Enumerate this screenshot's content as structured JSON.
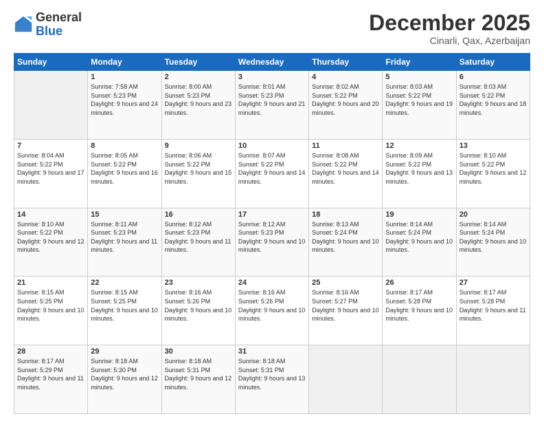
{
  "logo": {
    "line1": "General",
    "line2": "Blue"
  },
  "title": "December 2025",
  "location": "Cinarli, Qax, Azerbaijan",
  "days_header": [
    "Sunday",
    "Monday",
    "Tuesday",
    "Wednesday",
    "Thursday",
    "Friday",
    "Saturday"
  ],
  "weeks": [
    [
      {
        "num": "",
        "empty": true
      },
      {
        "num": "1",
        "sunrise": "7:58 AM",
        "sunset": "5:23 PM",
        "daylight": "9 hours and 24 minutes."
      },
      {
        "num": "2",
        "sunrise": "8:00 AM",
        "sunset": "5:23 PM",
        "daylight": "9 hours and 23 minutes."
      },
      {
        "num": "3",
        "sunrise": "8:01 AM",
        "sunset": "5:23 PM",
        "daylight": "9 hours and 21 minutes."
      },
      {
        "num": "4",
        "sunrise": "8:02 AM",
        "sunset": "5:22 PM",
        "daylight": "9 hours and 20 minutes."
      },
      {
        "num": "5",
        "sunrise": "8:03 AM",
        "sunset": "5:22 PM",
        "daylight": "9 hours and 19 minutes."
      },
      {
        "num": "6",
        "sunrise": "8:03 AM",
        "sunset": "5:22 PM",
        "daylight": "9 hours and 18 minutes."
      }
    ],
    [
      {
        "num": "7",
        "sunrise": "8:04 AM",
        "sunset": "5:22 PM",
        "daylight": "9 hours and 17 minutes."
      },
      {
        "num": "8",
        "sunrise": "8:05 AM",
        "sunset": "5:22 PM",
        "daylight": "9 hours and 16 minutes."
      },
      {
        "num": "9",
        "sunrise": "8:06 AM",
        "sunset": "5:22 PM",
        "daylight": "9 hours and 15 minutes."
      },
      {
        "num": "10",
        "sunrise": "8:07 AM",
        "sunset": "5:22 PM",
        "daylight": "9 hours and 14 minutes."
      },
      {
        "num": "11",
        "sunrise": "8:08 AM",
        "sunset": "5:22 PM",
        "daylight": "9 hours and 14 minutes."
      },
      {
        "num": "12",
        "sunrise": "8:09 AM",
        "sunset": "5:22 PM",
        "daylight": "9 hours and 13 minutes."
      },
      {
        "num": "13",
        "sunrise": "8:10 AM",
        "sunset": "5:22 PM",
        "daylight": "9 hours and 12 minutes."
      }
    ],
    [
      {
        "num": "14",
        "sunrise": "8:10 AM",
        "sunset": "5:22 PM",
        "daylight": "9 hours and 12 minutes."
      },
      {
        "num": "15",
        "sunrise": "8:11 AM",
        "sunset": "5:23 PM",
        "daylight": "9 hours and 11 minutes."
      },
      {
        "num": "16",
        "sunrise": "8:12 AM",
        "sunset": "5:23 PM",
        "daylight": "9 hours and 11 minutes."
      },
      {
        "num": "17",
        "sunrise": "8:12 AM",
        "sunset": "5:23 PM",
        "daylight": "9 hours and 10 minutes."
      },
      {
        "num": "18",
        "sunrise": "8:13 AM",
        "sunset": "5:24 PM",
        "daylight": "9 hours and 10 minutes."
      },
      {
        "num": "19",
        "sunrise": "8:14 AM",
        "sunset": "5:24 PM",
        "daylight": "9 hours and 10 minutes."
      },
      {
        "num": "20",
        "sunrise": "8:14 AM",
        "sunset": "5:24 PM",
        "daylight": "9 hours and 10 minutes."
      }
    ],
    [
      {
        "num": "21",
        "sunrise": "8:15 AM",
        "sunset": "5:25 PM",
        "daylight": "9 hours and 10 minutes."
      },
      {
        "num": "22",
        "sunrise": "8:15 AM",
        "sunset": "5:25 PM",
        "daylight": "9 hours and 10 minutes."
      },
      {
        "num": "23",
        "sunrise": "8:16 AM",
        "sunset": "5:26 PM",
        "daylight": "9 hours and 10 minutes."
      },
      {
        "num": "24",
        "sunrise": "8:16 AM",
        "sunset": "5:26 PM",
        "daylight": "9 hours and 10 minutes."
      },
      {
        "num": "25",
        "sunrise": "8:16 AM",
        "sunset": "5:27 PM",
        "daylight": "9 hours and 10 minutes."
      },
      {
        "num": "26",
        "sunrise": "8:17 AM",
        "sunset": "5:28 PM",
        "daylight": "9 hours and 10 minutes."
      },
      {
        "num": "27",
        "sunrise": "8:17 AM",
        "sunset": "5:28 PM",
        "daylight": "9 hours and 11 minutes."
      }
    ],
    [
      {
        "num": "28",
        "sunrise": "8:17 AM",
        "sunset": "5:29 PM",
        "daylight": "9 hours and 11 minutes."
      },
      {
        "num": "29",
        "sunrise": "8:18 AM",
        "sunset": "5:30 PM",
        "daylight": "9 hours and 12 minutes."
      },
      {
        "num": "30",
        "sunrise": "8:18 AM",
        "sunset": "5:31 PM",
        "daylight": "9 hours and 12 minutes."
      },
      {
        "num": "31",
        "sunrise": "8:18 AM",
        "sunset": "5:31 PM",
        "daylight": "9 hours and 13 minutes."
      },
      {
        "num": "",
        "empty": true
      },
      {
        "num": "",
        "empty": true
      },
      {
        "num": "",
        "empty": true
      }
    ]
  ]
}
